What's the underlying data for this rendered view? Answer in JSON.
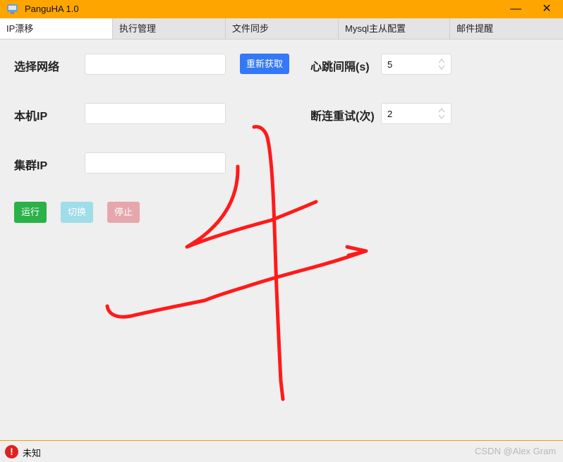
{
  "window": {
    "title": "PanguHA 1.0",
    "minimize": "—",
    "close": "✕"
  },
  "tabs": [
    {
      "label": "IP漂移",
      "active": true
    },
    {
      "label": "执行管理",
      "active": false
    },
    {
      "label": "文件同步",
      "active": false
    },
    {
      "label": "Mysql主从配置",
      "active": false
    },
    {
      "label": "邮件提醒",
      "active": false
    }
  ],
  "form": {
    "network_label": "选择网络",
    "network_value": "",
    "refresh_button": "重新获取",
    "local_ip_label": "本机IP",
    "local_ip_value": "",
    "cluster_ip_label": "集群IP",
    "cluster_ip_value": "",
    "heartbeat_label": "心跳间隔(s)",
    "heartbeat_value": "5",
    "retry_label": "断连重试(次)",
    "retry_value": "2"
  },
  "actions": {
    "run": "运行",
    "switch": "切换",
    "stop": "停止"
  },
  "status": {
    "text": "未知",
    "icon": "error-icon",
    "icon_glyph": "!"
  },
  "watermark": "CSDN @Alex Gram",
  "colors": {
    "titlebar": "#ffa500",
    "refresh_button": "#3478f6",
    "run_button": "#2ab148",
    "switch_button": "#9fdde8",
    "stop_button": "#e6a7ac",
    "annotation": "#ff1a1a"
  }
}
